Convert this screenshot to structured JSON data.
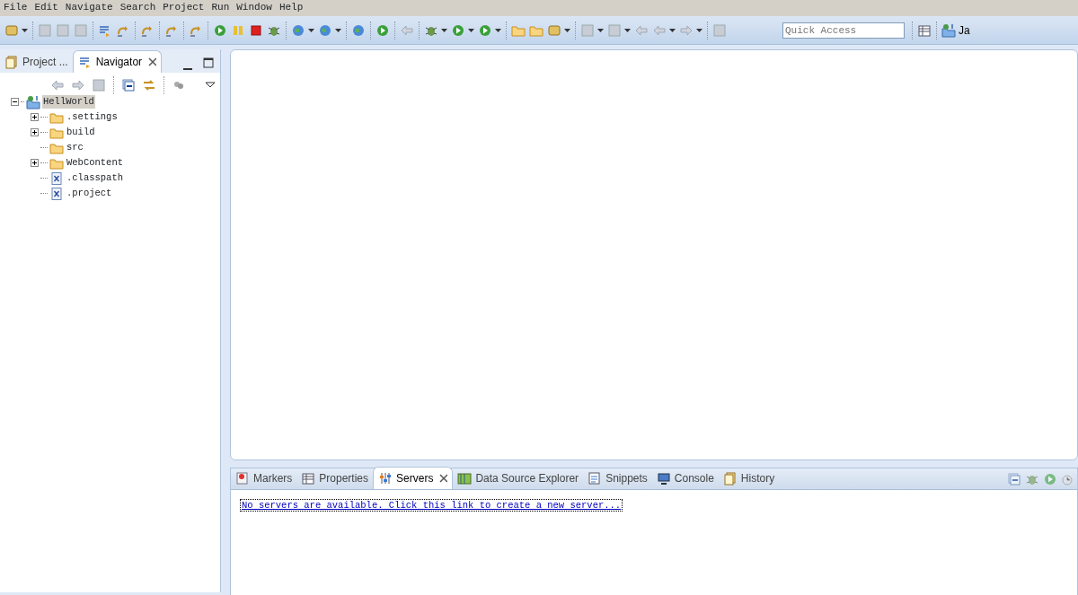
{
  "menu": [
    "File",
    "Edit",
    "Navigate",
    "Search",
    "Project",
    "Run",
    "Window",
    "Help"
  ],
  "quick_access": {
    "placeholder": "Quick Access"
  },
  "perspective": {
    "label": "Ja"
  },
  "left_panel": {
    "tabs": [
      {
        "label": "Project ...",
        "selected": false
      },
      {
        "label": "Navigator",
        "selected": true
      }
    ],
    "tree": [
      {
        "label": "HellWorld",
        "kind": "project",
        "selected": true,
        "expanded": true,
        "children": [
          {
            "label": ".settings",
            "kind": "folder",
            "selected": false,
            "expanded": false
          },
          {
            "label": "build",
            "kind": "folder",
            "selected": false,
            "expanded": false
          },
          {
            "label": "src",
            "kind": "folder",
            "selected": false
          },
          {
            "label": "WebContent",
            "kind": "folder",
            "selected": false,
            "expanded": false
          },
          {
            "label": ".classpath",
            "kind": "file",
            "selected": false
          },
          {
            "label": ".project",
            "kind": "file",
            "selected": false
          }
        ]
      }
    ]
  },
  "bottom_panel": {
    "tabs": [
      {
        "label": "Markers",
        "kind": "markers",
        "selected": false
      },
      {
        "label": "Properties",
        "kind": "properties",
        "selected": false
      },
      {
        "label": "Servers",
        "kind": "servers",
        "selected": true
      },
      {
        "label": "Data Source Explorer",
        "kind": "datasource",
        "selected": false
      },
      {
        "label": "Snippets",
        "kind": "snippets",
        "selected": false
      },
      {
        "label": "Console",
        "kind": "console",
        "selected": false
      },
      {
        "label": "History",
        "kind": "history",
        "selected": false
      }
    ],
    "link": "No servers are available. Click this link to create a new server..."
  }
}
